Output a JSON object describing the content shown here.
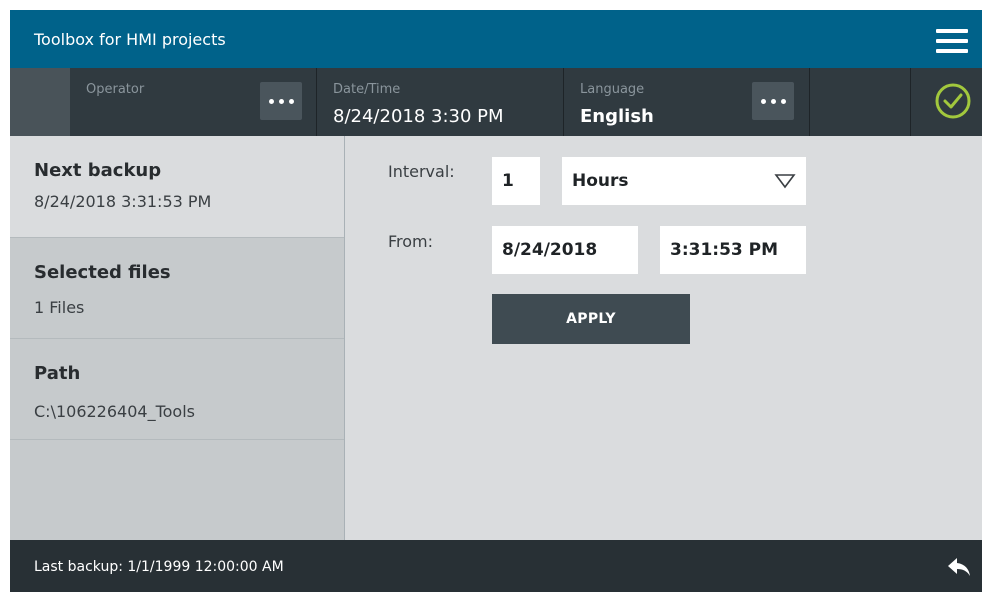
{
  "header": {
    "title": "Toolbox for HMI projects",
    "menu_icon": "hamburger-menu-icon"
  },
  "status": {
    "operator_label": "Operator",
    "operator_value": "",
    "datetime_label": "Date/Time",
    "datetime_value": "8/24/2018 3:30 PM",
    "language_label": "Language",
    "language_value": "English",
    "status_icon": "check-circle-icon",
    "status_color": "#a2c83d"
  },
  "sidebar": {
    "items": [
      {
        "title": "Next backup",
        "value": "8/24/2018 3:31:53 PM"
      },
      {
        "title": "Selected files",
        "value": "1 Files"
      },
      {
        "title": "Path",
        "value": "C:\\106226404_Tools"
      }
    ]
  },
  "form": {
    "interval_label": "Interval:",
    "interval_value": "1",
    "unit_value": "Hours",
    "from_label": "From:",
    "from_date": "8/24/2018",
    "from_time": "3:31:53 PM",
    "apply_label": "APPLY"
  },
  "footer": {
    "last_backup": "Last backup: 1/1/1999 12:00:00 AM",
    "back_icon": "back-arrow-icon"
  },
  "colors": {
    "title_bar": "#00628a",
    "status_bar": "#303a40",
    "footer": "#283035",
    "content_bg": "#dadcde"
  }
}
